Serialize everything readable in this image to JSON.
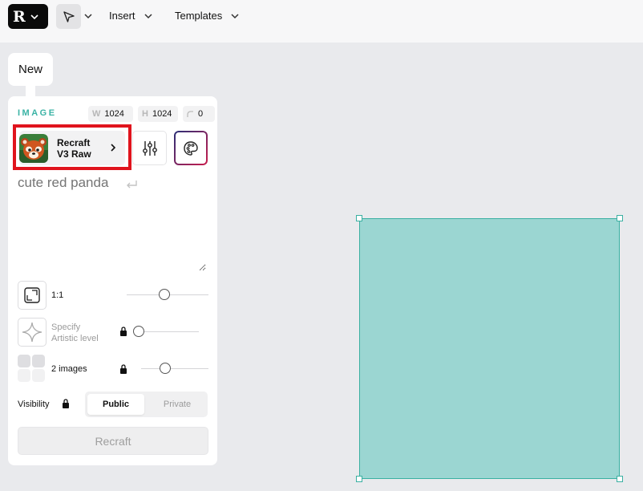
{
  "toolbar": {
    "logo_mark": "R",
    "insert_label": "Insert",
    "templates_label": "Templates"
  },
  "panel": {
    "new_tab": "New",
    "section_label": "IMAGE",
    "width_key": "W",
    "width": "1024",
    "height_key": "H",
    "height": "1024",
    "seed": "0",
    "model_line1": "Recraft",
    "model_line2": "V3 Raw",
    "prompt_placeholder": "cute red panda",
    "aspect_label": "1:1",
    "artistic_line1": "Specify",
    "artistic_line2": "Artistic level",
    "images_label": "2 images",
    "visibility_label": "Visibility",
    "visibility_options": [
      "Public",
      "Private"
    ],
    "visibility_selected": "Public",
    "generate_label": "Recraft"
  },
  "icons": {
    "logo": "recraft-logo",
    "select_tool": "cursor-arrow-icon",
    "model_thumb": "red-panda-thumbnail",
    "settings": "sliders-icon",
    "palette": "palette-icon",
    "aspect": "frame-corners-icon",
    "artistic": "sparkle-icon",
    "images": "grid-icon",
    "lock": "lock-icon"
  },
  "colors": {
    "accent": "#3bb3a5",
    "highlight_frame": "#e0141d",
    "canvas_fill": "#9bd6d2",
    "canvas_border": "#3ab0a2"
  }
}
